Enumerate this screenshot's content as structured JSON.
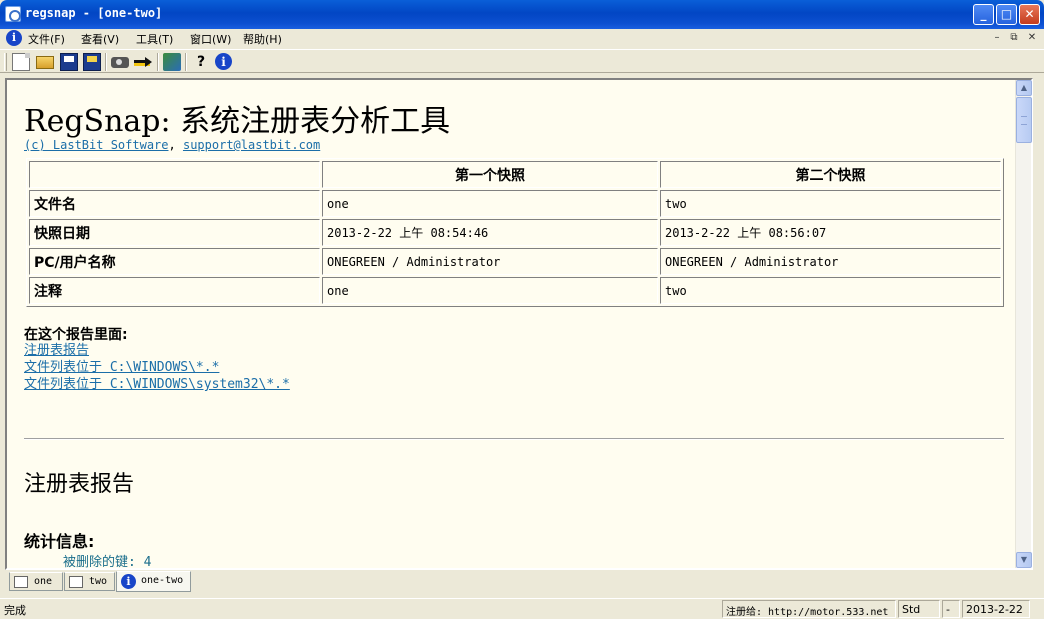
{
  "window": {
    "title": "regsnap - [one-two]"
  },
  "menu": {
    "items": [
      "文件(F)",
      "查看(V)",
      "工具(T)",
      "窗口(W)",
      "帮助(H)"
    ]
  },
  "toolbar": {
    "buttons": [
      "new-icon",
      "open-icon",
      "save-icon",
      "save-all-icon",
      "camera-icon",
      "compare-arrow-icon",
      "tools-icon",
      "help-icon",
      "about-icon"
    ]
  },
  "report": {
    "title": "RegSnap: 系统注册表分析工具",
    "credit_link": "(c) LastBit Software",
    "credit_sep": ",",
    "support_link": "support@lastbit.com",
    "table": {
      "headers": [
        "",
        "第一个快照",
        "第二个快照"
      ],
      "rows": [
        {
          "label": "文件名",
          "first": "one",
          "second": "two"
        },
        {
          "label": "快照日期",
          "first": "2013-2-22 上午 08:54:46",
          "second": "2013-2-22 上午 08:56:07"
        },
        {
          "label": "PC/用户名称",
          "first": "ONEGREEN / Administrator",
          "second": "ONEGREEN / Administrator"
        },
        {
          "label": "注释",
          "first": "one",
          "second": "two"
        }
      ]
    },
    "in_report_label": "在这个报告里面:",
    "toc_links": [
      "注册表报告",
      "文件列表位于 C:\\WINDOWS\\*.*",
      "文件列表位于 C:\\WINDOWS\\system32\\*.*"
    ],
    "registry_heading": "注册表报告",
    "stats_label": "统计信息:",
    "deleted_keys": "被删除的键: 4"
  },
  "tabs": [
    {
      "label": "one",
      "active": false
    },
    {
      "label": "two",
      "active": false
    },
    {
      "label": "one-two",
      "active": true
    }
  ],
  "status": {
    "text": "完成",
    "registered": "注册给: http://motor.533.net",
    "mode": "Std",
    "dash": "-",
    "date": "2013-2-22"
  }
}
